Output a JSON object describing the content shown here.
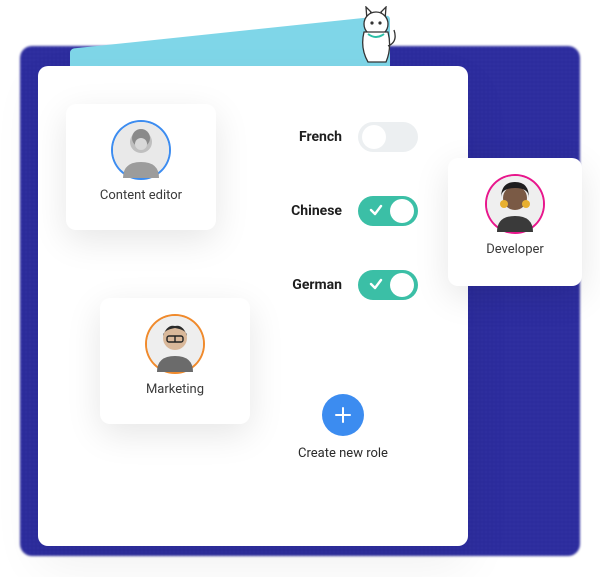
{
  "roles": {
    "editor": {
      "label": "Content editor"
    },
    "marketing": {
      "label": "Marketing"
    },
    "developer": {
      "label": "Developer"
    }
  },
  "languages": [
    {
      "label": "French",
      "on": false
    },
    {
      "label": "Chinese",
      "on": true
    },
    {
      "label": "German",
      "on": true
    }
  ],
  "create_role_label": "Create new role"
}
